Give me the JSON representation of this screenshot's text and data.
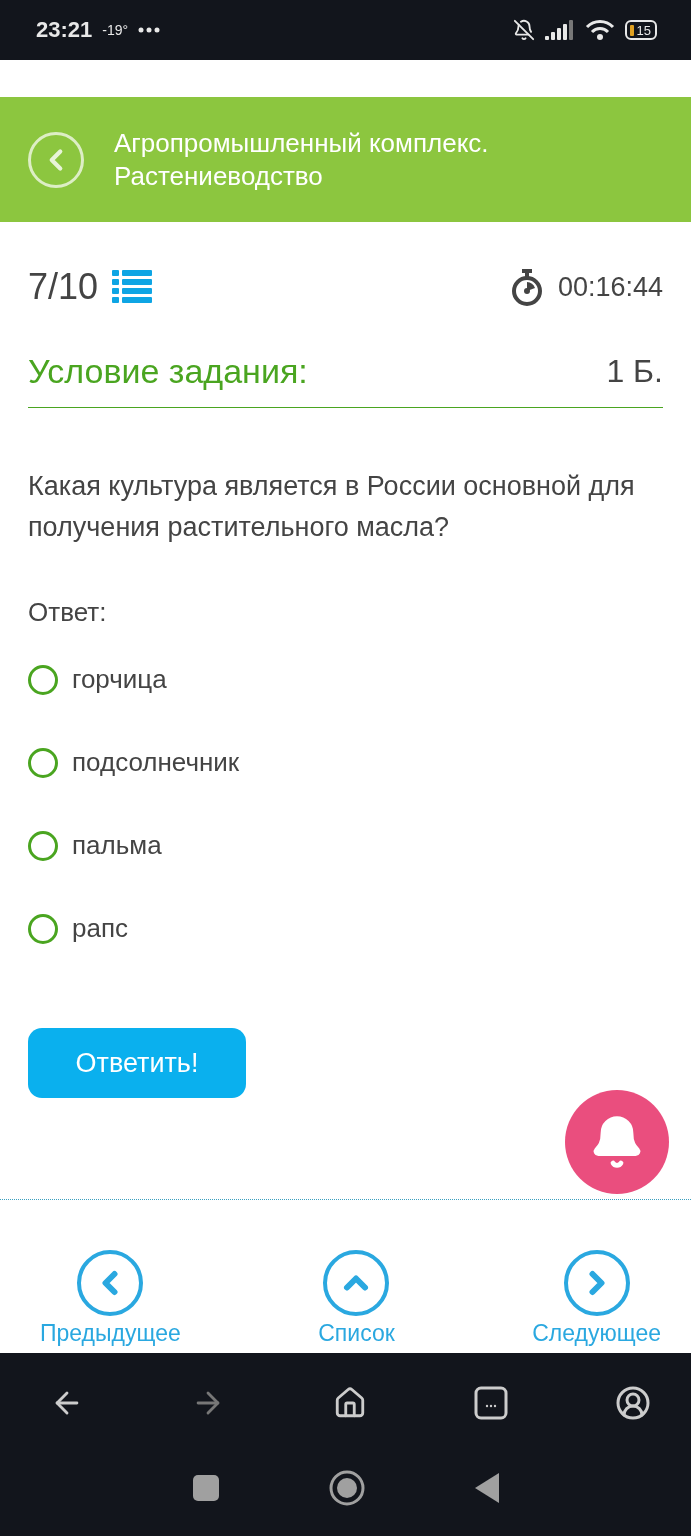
{
  "status_bar": {
    "time": "23:21",
    "temperature": "-19°",
    "battery": "15"
  },
  "header": {
    "title": "Агропромышленный комплекс. Растениеводство"
  },
  "progress": {
    "counter": "7/10",
    "timer": "00:16:44"
  },
  "task": {
    "heading": "Условие задания:",
    "points": "1 Б.",
    "question": "Какая культура является в России основной для получения растительного масла?",
    "answer_label": "Ответ:",
    "options": [
      {
        "label": "горчица",
        "selected": false
      },
      {
        "label": "подсолнечник",
        "selected": false
      },
      {
        "label": "пальма",
        "selected": false
      },
      {
        "label": "рапс",
        "selected": false
      }
    ],
    "submit": "Ответить!"
  },
  "bottom_nav": [
    {
      "kind": "previous",
      "label": "Предыдущее"
    },
    {
      "kind": "list",
      "label": "Список"
    },
    {
      "kind": "next",
      "label": "Следующее"
    }
  ]
}
